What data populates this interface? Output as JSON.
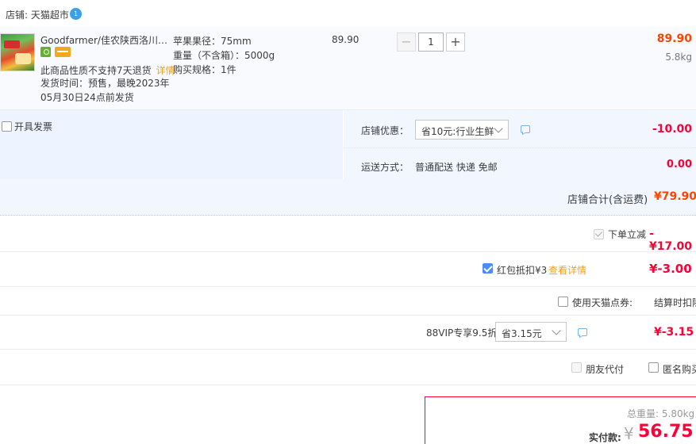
{
  "shop": {
    "label": "店铺: 天猫超市",
    "ww_badge": "1"
  },
  "item": {
    "title": "Goodfarmer/佳农陕西洛川苹果",
    "no_return_text": "此商品性质不支持7天退货",
    "detail_link": "详情",
    "ship_time": "发货时间：预售，最晚2023年05月30日24点前发货",
    "spec_diameter": "苹果果径：75mm",
    "spec_weight": "重量（不含箱）：5000g",
    "spec_buy": "购买规格：1件",
    "unit_price": "89.90",
    "quantity": "1",
    "minus": "−",
    "plus": "+",
    "subtotal": "89.90",
    "weight": "5.8kg",
    "badges": [
      "certified-icon",
      "card-icon"
    ]
  },
  "options": {
    "invoice_label": "开具发票",
    "coupon_label": "店铺优惠：",
    "coupon_selected": "省10元:行业生鲜",
    "coupon_amount": "-10.00",
    "delivery_label": "运送方式：",
    "delivery_value": "普通配送 快递 免邮",
    "delivery_amount": "0.00"
  },
  "shop_total": {
    "label": "店铺合计(含运费)",
    "value": "¥79.90"
  },
  "discounts": {
    "order_off_label": "下单立减",
    "order_off_value": "-¥17.00",
    "redpacket_label": "红包抵扣¥3",
    "redpacket_link": "查看详情",
    "redpacket_value": "¥-3.00",
    "tmall_points_label": "使用天猫点券:",
    "tmall_points_value": "结算时扣除",
    "vip_label": "88VIP专享9.5折",
    "vip_selected": "省3.15元",
    "vip_value": "¥-3.15",
    "friend_pay_label": "朋友代付",
    "anonymous_label": "匿名购买"
  },
  "summary": {
    "weight_label": "总重量:",
    "weight_value": "5.80kg",
    "pay_label": "实付款:",
    "currency": "¥",
    "pay_value": "56.75"
  },
  "colors": {
    "accent_red": "#ff0036",
    "orange": "#ff4400",
    "link_orange": "#f0a020",
    "blue_check": "#4d8cf5",
    "row_bg": "#f2f7ff"
  }
}
